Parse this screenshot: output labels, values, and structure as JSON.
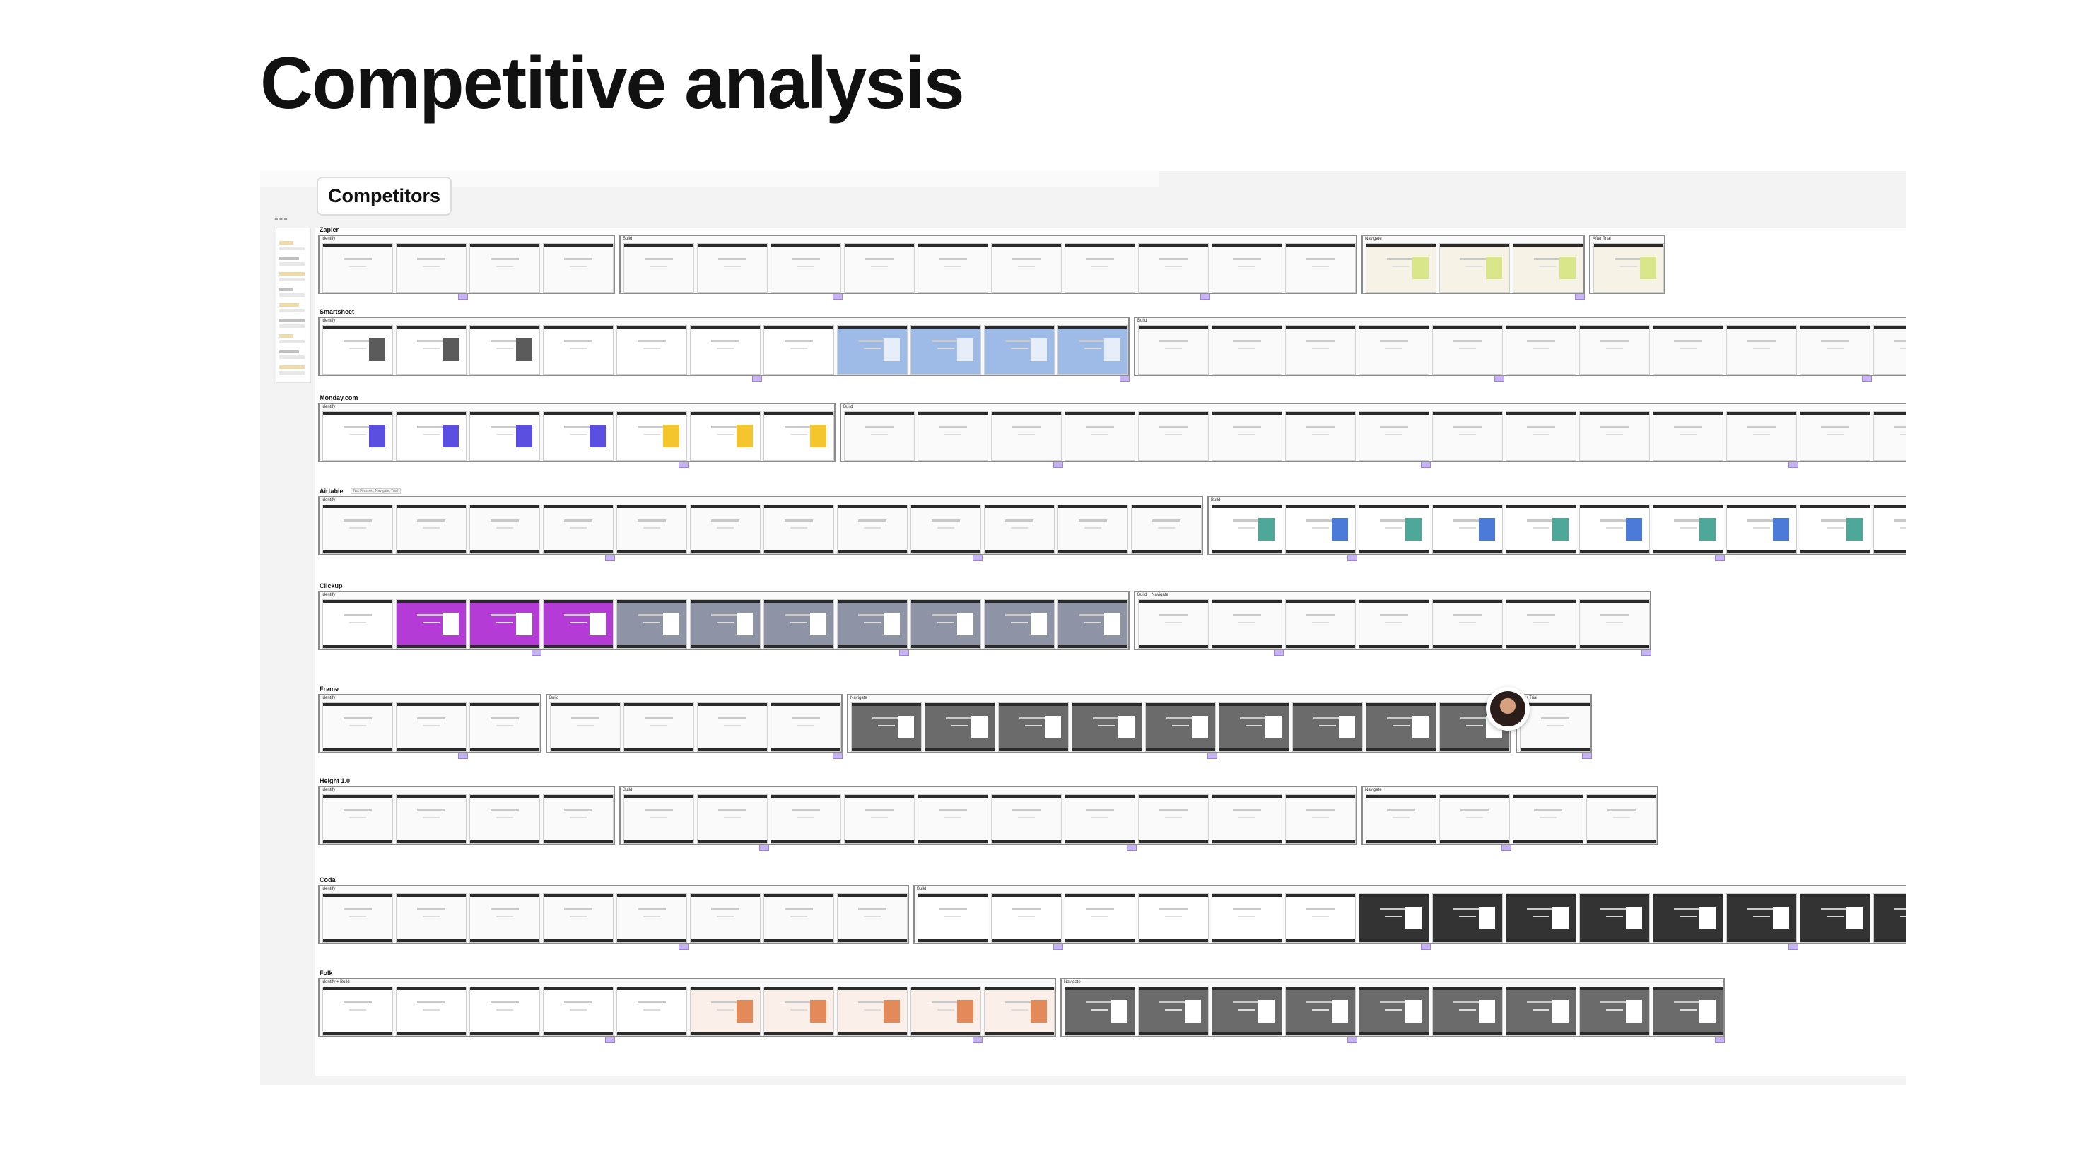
{
  "slide": {
    "title": "Competitive analysis"
  },
  "board": {
    "frame_label": "Competitors",
    "menu_glyph": "•••"
  },
  "colors": {
    "thumb_default": "#fafafa",
    "zapier_accent": "#f6f3e6",
    "smartsheet_accent": "#9dbbe6",
    "monday_purple": "#5a4fe0",
    "monday_yellow": "#f4c52d",
    "monday_green": "#3fbf5f",
    "airtable_teal": "#4ea89a",
    "clickup_gradient": "#b43bd6",
    "dark_gray": "#6b6b6b",
    "marker": "#c7b3f2"
  },
  "rows": [
    {
      "name": "Zapier",
      "groups": [
        {
          "label": "Identify",
          "count": 4,
          "style": "light"
        },
        {
          "label": "Build",
          "count": 10,
          "style": "light"
        },
        {
          "label": "Navigate",
          "count": 3,
          "style": "yellowish"
        },
        {
          "label": "After Trial",
          "count": 1,
          "style": "yellowish"
        }
      ]
    },
    {
      "name": "Smartsheet",
      "groups": [
        {
          "label": "Identify",
          "count": 11,
          "style": "smartsheet"
        },
        {
          "label": "Build",
          "count": 11,
          "style": "light"
        }
      ]
    },
    {
      "name": "Monday.com",
      "groups": [
        {
          "label": "Identify",
          "count": 7,
          "style": "monday"
        },
        {
          "label": "Build",
          "count": 15,
          "style": "light"
        }
      ]
    },
    {
      "name": "Airtable",
      "tag": "Not Finished, Navigate, Trial",
      "groups": [
        {
          "label": "Identify",
          "count": 12,
          "style": "light"
        },
        {
          "label": "Build",
          "count": 10,
          "style": "airtable"
        }
      ]
    },
    {
      "name": "Clickup",
      "groups": [
        {
          "label": "Identify",
          "count": 11,
          "style": "clickup"
        },
        {
          "label": "Build + Navigate",
          "count": 7,
          "style": "light"
        }
      ]
    },
    {
      "name": "Frame",
      "groups": [
        {
          "label": "Identify",
          "count": 3,
          "style": "light"
        },
        {
          "label": "Build",
          "count": 4,
          "style": "light"
        },
        {
          "label": "Navigate",
          "count": 9,
          "style": "gray"
        },
        {
          "label": "After Trial",
          "count": 1,
          "style": "light"
        }
      ]
    },
    {
      "name": "Height 1.0",
      "groups": [
        {
          "label": "Identify",
          "count": 4,
          "style": "light"
        },
        {
          "label": "Build",
          "count": 10,
          "style": "light"
        },
        {
          "label": "Navigate",
          "count": 4,
          "style": "light"
        }
      ]
    },
    {
      "name": "Coda",
      "groups": [
        {
          "label": "Identify",
          "count": 8,
          "style": "light"
        },
        {
          "label": "Build",
          "count": 14,
          "style": "dark"
        }
      ]
    },
    {
      "name": "Folk",
      "groups": [
        {
          "label": "Identify + Build",
          "count": 10,
          "style": "folk"
        },
        {
          "label": "Navigate",
          "count": 9,
          "style": "gray"
        }
      ]
    }
  ]
}
